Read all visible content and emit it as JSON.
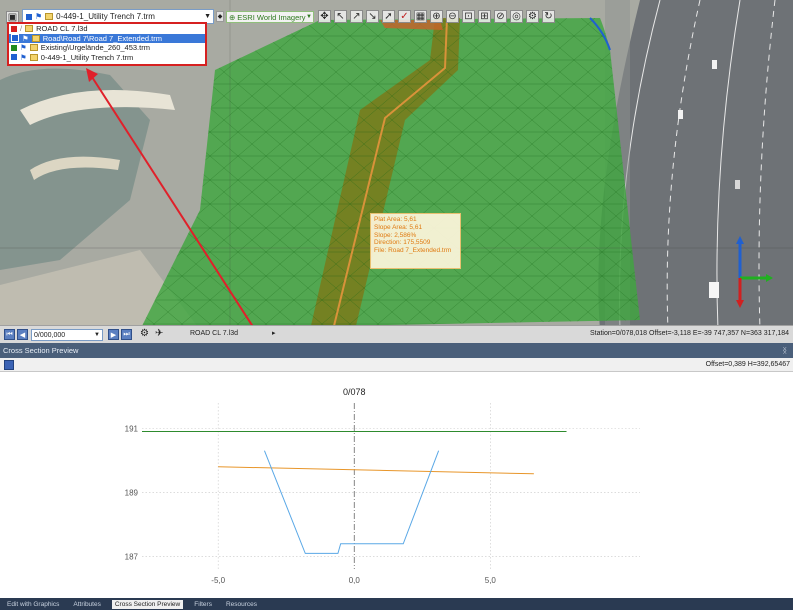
{
  "toolbar": {
    "layer_combo_value": "0-449-1_Utility Trench 7.trm",
    "basemap_label": "ESRI World Imagery",
    "layers": [
      {
        "name": "ROAD CL 7.l3d",
        "color": "#d62020",
        "selected": false
      },
      {
        "name": "Road\\Road 7\\Road 7_Extended.trm",
        "color": "#2060d0",
        "selected": true
      },
      {
        "name": "Existing\\Urgelände_260_453.trm",
        "color": "#208a20",
        "selected": false
      },
      {
        "name": "0-449-1_Utility Trench 7.trm",
        "color": "#2060d0",
        "selected": false
      }
    ]
  },
  "tooltip": {
    "lines": [
      "Plat Area: 5,61",
      "Slope Area: 5,61",
      "Slope: 2,586%",
      "Direction: 175,5509",
      "File: Road 7_Extended.trm"
    ]
  },
  "navbar": {
    "scale_value": "0/000,000",
    "alignment_label": "ROAD CL 7.l3d",
    "status": "Station=0/078,018  Offset=-3,118  E=-39 747,357  N=363 317,184"
  },
  "cross_section": {
    "title": "Cross Section Preview",
    "offset_readout": "Offset=0,389  H=392,65467",
    "station_label": "0/078"
  },
  "tabs": [
    "Edit with Graphics",
    "Attributes",
    "Cross Section Preview",
    "Filters",
    "Resources"
  ],
  "active_tab": 2,
  "colors": {
    "terrain": "#2e8b2e",
    "design": "#e8962a",
    "trench": "#5aa8e6",
    "accent": "#d62020"
  },
  "chart_data": {
    "type": "line",
    "title": "",
    "xlabel": "",
    "ylabel": "",
    "station": "0/078",
    "xlim": [
      -7.8,
      10.5
    ],
    "ylim": [
      186.8,
      191.6
    ],
    "x_ticks": [
      "-5,0",
      "0,0",
      "5,0"
    ],
    "x_tick_values": [
      -5,
      0,
      5
    ],
    "y_ticks": [
      "187",
      "189",
      "191"
    ],
    "y_tick_values": [
      187,
      189,
      191
    ],
    "grid": true,
    "series": [
      {
        "color": "#2e8b2e",
        "x": [
          -7.8,
          7.8
        ],
        "y": [
          190.9,
          190.9
        ]
      },
      {
        "color": "#e8962a",
        "x": [
          -5.0,
          6.6
        ],
        "y": [
          189.8,
          189.58
        ]
      },
      {
        "color": "#5aa8e6",
        "x": [
          -3.3,
          -1.8,
          -0.6,
          -0.5,
          1.8,
          3.1
        ],
        "y": [
          190.3,
          187.1,
          187.1,
          187.4,
          187.4,
          190.3
        ]
      }
    ]
  }
}
